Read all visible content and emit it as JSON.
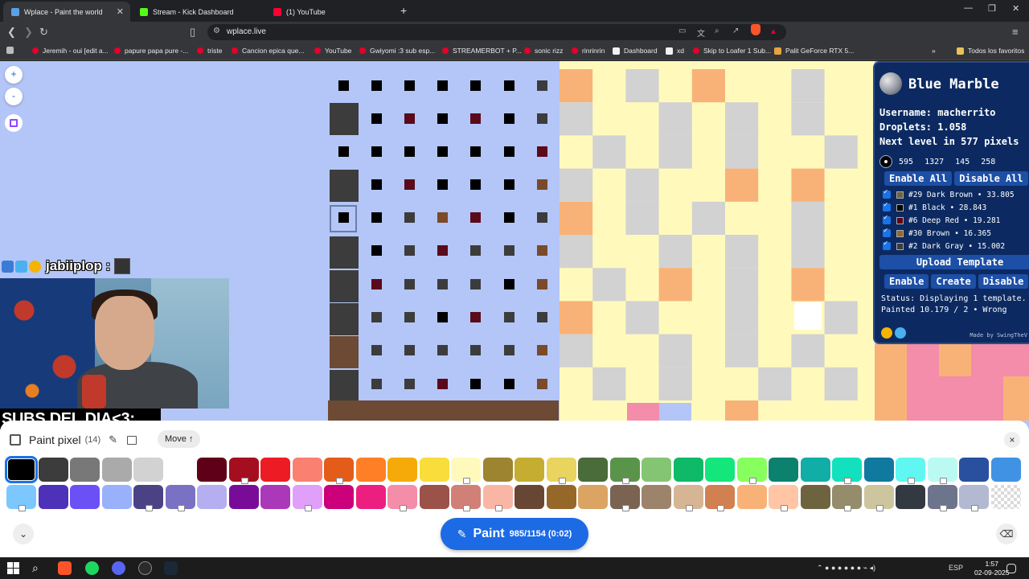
{
  "browser": {
    "tabs": [
      {
        "title": "Wplace - Paint the world",
        "active": true,
        "favicon_color": "#5aa0e6"
      },
      {
        "title": "Stream - Kick Dashboard",
        "active": false,
        "favicon_color": "#53fc18"
      },
      {
        "title": "(1) YouTube",
        "active": false,
        "favicon_color": "#ff0033"
      }
    ],
    "url": "wplace.live",
    "bookmarks": [
      "Jeremih - oui [edit a...",
      "papure papa pure -...",
      "triste",
      "Cancion epica que...",
      "YouTube",
      "Gwiyomi :3 sub esp...",
      "STREAMERBOT + P...",
      "sonic rizz",
      "rinrinrin",
      "Dashboard",
      "xd",
      "Skip to Loafer 1 Sub...",
      "Palit GeForce RTX 5..."
    ],
    "bookmarks_folder": "Todos los favoritos"
  },
  "map": {
    "zoom_in": "+",
    "zoom_out": "-"
  },
  "stream": {
    "chat_user": "jabiiplop :",
    "subs_banner": "SUBS DEL DIA<3:"
  },
  "blue_marble": {
    "title": "Blue Marble",
    "username_line": "Username: macherrito",
    "droplets_line": "Droplets: 1.058",
    "next_level_prefix": "Next level in ",
    "next_level_value": "577",
    "next_level_suffix": " pixels",
    "coords": [
      "595",
      "1327",
      "145",
      "258"
    ],
    "enable_all": "Enable All",
    "disable_all": "Disable All",
    "colors": [
      {
        "label": "#29 Dark Brown • 33.805",
        "swatch": "#6d643f"
      },
      {
        "label": "#1 Black • 28.843",
        "swatch": "#000000"
      },
      {
        "label": "#6 Deep Red • 19.281",
        "swatch": "#600018"
      },
      {
        "label": "#30 Brown • 16.365",
        "swatch": "#95682a"
      },
      {
        "label": "#2 Dark Gray • 15.002",
        "swatch": "#3c3c3c"
      }
    ],
    "upload_template": "Upload Template",
    "enable": "Enable",
    "create": "Create",
    "disable": "Disable",
    "status": "Status: Displaying 1 template.",
    "painted": "Painted 10.179 / 2 • Wrong",
    "made_by": "Made by SwingTheV"
  },
  "palette": {
    "title": "Paint pixel",
    "count": "(14)",
    "move_label": "Move ↑",
    "close": "×",
    "colors_row1": [
      "#000000",
      "#3c3c3c",
      "#787878",
      "#aaaaaa",
      "#d2d2d2",
      "#ffffff",
      "#600018",
      "#a50e1e",
      "#ed1c24",
      "#fa8072",
      "#e45c1a",
      "#ff7f27",
      "#f6aa09",
      "#f9dd3b",
      "#fffabc",
      "#9c8431",
      "#c5ad31",
      "#e8d45f",
      "#4a6b3a",
      "#5a944a",
      "#84c573",
      "#0eb968",
      "#13e67b",
      "#87ff5e",
      "#0c816e",
      "#10aea6",
      "#13e1be",
      "#0f799f",
      "#60f7f2",
      "#bbfaf2",
      "#28509e",
      "#4093e4"
    ],
    "colors_row2": [
      "#7dc7ff",
      "#4d31b8",
      "#6b50f6",
      "#99b1fb",
      "#4a4284",
      "#7a71c4",
      "#b5aef1",
      "#780c99",
      "#aa38b9",
      "#e09ff9",
      "#cb007a",
      "#ec1f80",
      "#f38da9",
      "#9b5249",
      "#d18078",
      "#fab6a4",
      "#684634",
      "#95682a",
      "#dba463",
      "#7b6352",
      "#9c846b",
      "#d6b594",
      "#d18051",
      "#f8b277",
      "#ffc5a5",
      "#6d643f",
      "#948c6b",
      "#cdc59e",
      "#333941",
      "#6d758d",
      "#b3b9d1",
      "transparent"
    ],
    "locked_row1": [
      false,
      false,
      false,
      false,
      false,
      false,
      false,
      true,
      false,
      false,
      true,
      false,
      false,
      false,
      true,
      false,
      false,
      true,
      false,
      true,
      false,
      false,
      false,
      true,
      false,
      false,
      true,
      false,
      true,
      true,
      false,
      false
    ],
    "locked_row2": [
      true,
      false,
      false,
      false,
      true,
      true,
      false,
      false,
      false,
      true,
      false,
      false,
      true,
      false,
      true,
      true,
      false,
      false,
      false,
      true,
      false,
      true,
      true,
      false,
      true,
      false,
      true,
      true,
      false,
      true,
      true,
      false
    ],
    "selected_index": 0,
    "paint_label": "Paint",
    "paint_counter": "985/1154 (0:02)"
  },
  "taskbar": {
    "language": "ESP",
    "time": "1:57",
    "date": "02-09-2025"
  }
}
